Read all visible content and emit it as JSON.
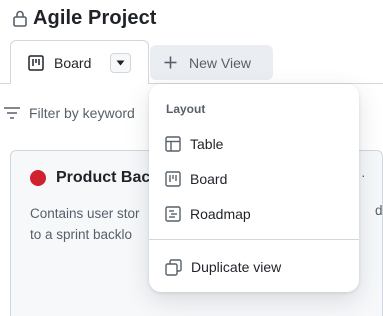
{
  "project": {
    "title": "Agile Project",
    "lock_icon": "lock-icon"
  },
  "tabs": {
    "board_label": "Board",
    "board_icon": "project-board-icon",
    "caret_icon": "triangle-down-icon",
    "new_view_label": "New View",
    "new_view_icon": "plus-icon"
  },
  "filter": {
    "placeholder": "Filter by keyword",
    "icon": "filter-icon"
  },
  "column": {
    "title": "Product Bac",
    "status_color": "#cf222e",
    "description_lines": [
      "Contains user stor",
      "to a sprint backlo"
    ],
    "description_trail": "d",
    "more_glyph": "·"
  },
  "menu": {
    "heading": "Layout",
    "items": [
      {
        "label": "Table",
        "icon": "table-icon"
      },
      {
        "label": "Board",
        "icon": "project-board-icon"
      },
      {
        "label": "Roadmap",
        "icon": "roadmap-icon"
      }
    ],
    "duplicate": {
      "label": "Duplicate view",
      "icon": "duplicate-icon"
    }
  },
  "colors": {
    "accent_red": "#cf222e",
    "border": "#d0d7de",
    "muted_text": "#57606a"
  }
}
